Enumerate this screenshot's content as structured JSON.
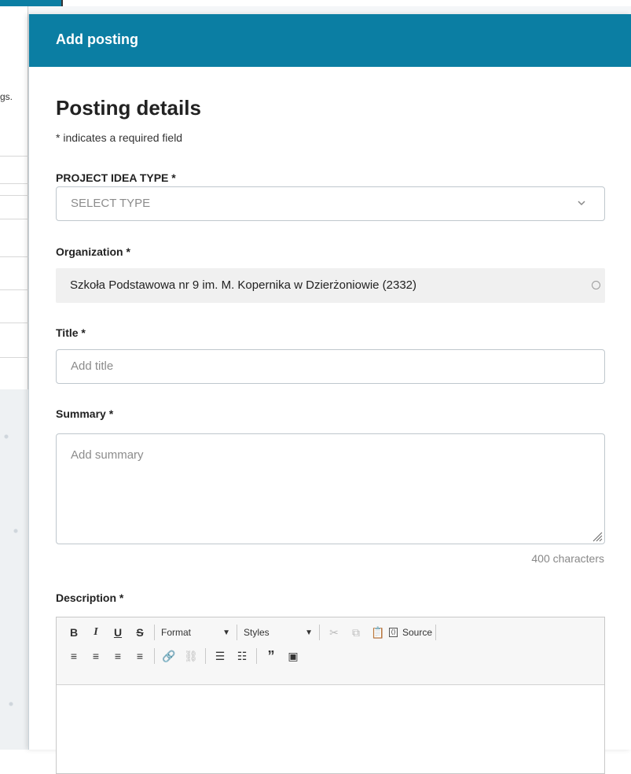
{
  "background": {
    "fragment_text": "gs."
  },
  "modal": {
    "title": "Add posting"
  },
  "form": {
    "section_title": "Posting details",
    "required_note": "* indicates a required field",
    "project_type": {
      "label": "PROJECT IDEA TYPE *",
      "value": "SELECT TYPE"
    },
    "organization": {
      "label": "Organization *",
      "value": "Szkoła Podstawowa nr 9 im. M. Kopernika w Dzierżoniowie (2332)"
    },
    "title": {
      "label": "Title *",
      "placeholder": "Add title"
    },
    "summary": {
      "label": "Summary *",
      "placeholder": "Add summary",
      "char_count": "400 characters"
    },
    "description": {
      "label": "Description *"
    }
  },
  "editor_toolbar": {
    "bold": "B",
    "italic": "I",
    "underline": "U",
    "strike": "S",
    "format_label": "Format",
    "styles_label": "Styles",
    "source_label": "Source"
  },
  "colors": {
    "header": "#0b7ea3",
    "org_bg": "#f0f0f0"
  }
}
